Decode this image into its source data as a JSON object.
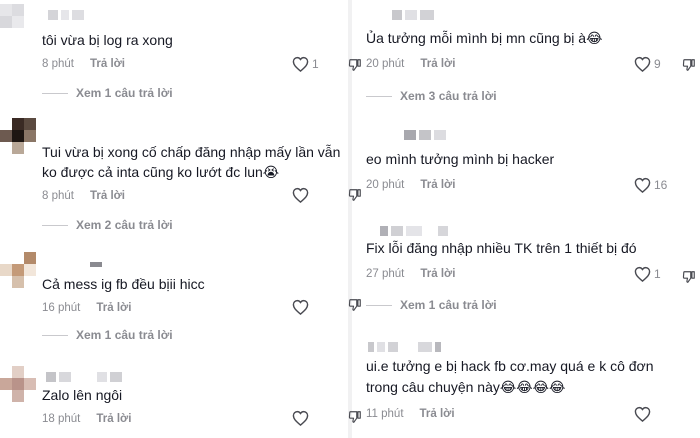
{
  "left_comments": [
    {
      "text": "tôi vừa bị log ra xong",
      "time": "8 phút",
      "reply": "Trả lời",
      "likes": "1",
      "more": "Xem 1 câu trả lời"
    },
    {
      "text_line1": "Tui vừa bị xong cố chấp đăng nhập mấy lần vẫn",
      "text_line2": "ko được cả inta cũng ko lướt đc lun",
      "emoji": "😭",
      "time": "8 phút",
      "reply": "Trả lời",
      "likes": "",
      "more": "Xem 2 câu trả lời"
    },
    {
      "text": "Cả mess ig fb đều bịii hicc",
      "time": "16 phút",
      "reply": "Trả lời",
      "likes": "",
      "more": "Xem 1 câu trả lời"
    },
    {
      "text": "Zalo lên ngôi",
      "time": "18 phút",
      "reply": "Trả lời",
      "likes": ""
    }
  ],
  "right_comments": [
    {
      "text": "Ủa tưởng mỗi mình bị mn cũng bị à",
      "emoji": "😂",
      "time": "20 phút",
      "reply": "Trả lời",
      "likes": "9",
      "more": "Xem 3 câu trả lời"
    },
    {
      "text": "eo mình tưởng mình bị hacker",
      "time": "20 phút",
      "reply": "Trả lời",
      "likes": "16"
    },
    {
      "text": "Fix lỗi đăng nhập nhiều TK trên 1 thiết bị đó",
      "time": "27 phút",
      "reply": "Trả lời",
      "likes": "1",
      "more": "Xem 1 câu trả lời"
    },
    {
      "text_line1": "ui.e tưởng e bị hack fb cơ.may quá e k cô đơn",
      "text_line2": "trong câu chuyện này",
      "emoji": "😂😂😂😂",
      "time": "11 phút",
      "reply": "Trả lời",
      "likes": ""
    }
  ],
  "icons": {
    "like": "heart-outline-icon",
    "dislike": "thumbs-down-icon",
    "laugh": "face-tears-of-joy-emoji",
    "cry": "loudly-crying-emoji"
  },
  "colors": {
    "text": "#161823",
    "meta": "#8a8b91",
    "divider": "#f1f1f2"
  }
}
